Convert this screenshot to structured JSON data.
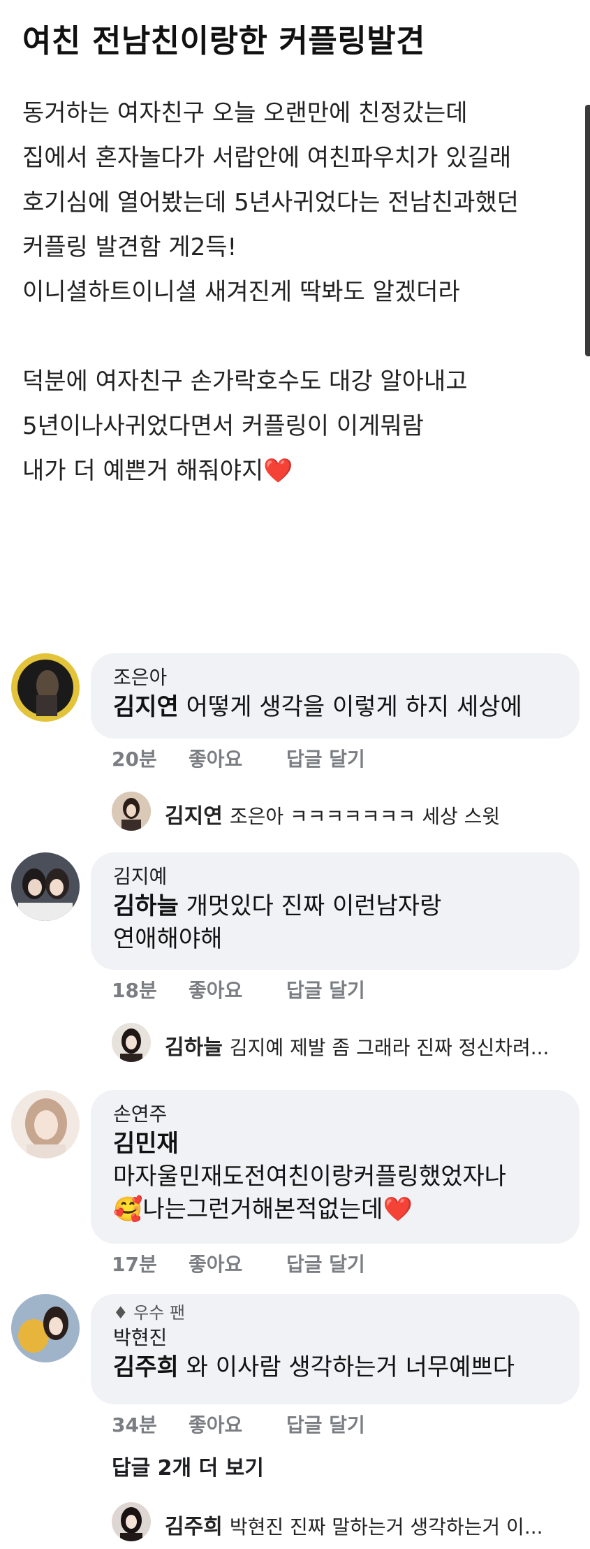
{
  "post": {
    "title": "여친 전남친이랑한 커플링발견",
    "lines": [
      "동거하는 여자친구 오늘 오랜만에 친정갔는데",
      "집에서 혼자놀다가 서랍안에 여친파우치가 있길래",
      "호기심에 열어봤는데 5년사귀었다는 전남친과했던",
      "커플링 발견함 게2득!",
      "이니셜하트이니셜 새겨진게 딱봐도 알겠더라",
      "덕분에 여자친구 손가락호수도 대강 알아내고",
      "5년이나사귀었다면서 커플링이 이게뭐람",
      "내가 더 예쁜거 해줘야지"
    ],
    "heart_emoji": "❤️"
  },
  "comments": [
    {
      "author": "조은아",
      "tag": "김지연",
      "text": " 어떻게 생각을 이렇게 하지 세상에",
      "time": "20분",
      "like": "좋아요",
      "reply": "답글 달기",
      "reply_preview": {
        "name": "김지연",
        "text": "조은아 ㅋㅋㅋㅋㅋㅋㅋ 세상 스윗"
      }
    },
    {
      "author": "김지예",
      "tag": "김하늘",
      "text": " 개멋있다 진짜 이런남자랑",
      "text2": "연애해야해",
      "time": "18분",
      "like": "좋아요",
      "reply": "답글 달기",
      "reply_preview": {
        "name": "김하늘",
        "text": "김지예 제발 좀 그래라 진짜 정신차려..."
      }
    },
    {
      "author": "손연주",
      "tag": "김민재",
      "text": "마자울민재도전여친이랑커플링했었자나",
      "emoji_start": "🥰",
      "text2": "나는그런거해본적없는데",
      "emoji_end": "❤️",
      "time": "17분",
      "like": "좋아요",
      "reply": "답글 달기"
    },
    {
      "badge": "우수 팬",
      "author": "박현진",
      "tag": "김주희",
      "text": " 와 이사람 생각하는거 너무예쁘다",
      "time": "34분",
      "like": "좋아요",
      "reply": "답글 달기",
      "more_replies": "답글 2개 더 보기",
      "reply_preview": {
        "name": "김주희",
        "text": "박현진 진짜 말하는거 생각하는거 이..."
      }
    }
  ],
  "colors": {
    "bubble": "#f0f2f5",
    "meta": "#7a7d82",
    "heart": "#e0243b"
  },
  "icons": [
    "diamond-icon"
  ]
}
